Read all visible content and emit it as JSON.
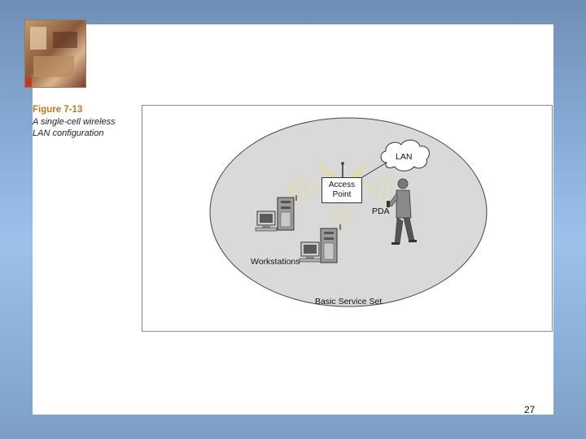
{
  "caption": {
    "figure_number": "Figure 7-13",
    "description_line1": "A single-cell wireless",
    "description_line2": "LAN configuration"
  },
  "diagram": {
    "lan_label": "LAN",
    "access_point_line1": "Access",
    "access_point_line2": "Point",
    "pda_label": "PDA",
    "workstations_label": "Workstations",
    "bss_label": "Basic Service Set"
  },
  "colors": {
    "caption_title": "#c17a16",
    "bss_fill": "#d9d9d9",
    "wave": "#e3dc84"
  },
  "footer": {
    "page_number": "27"
  }
}
